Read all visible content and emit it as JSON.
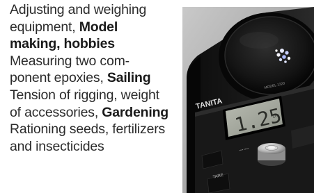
{
  "text": {
    "line1": "Adjusting and weighing",
    "line2": "equipment,",
    "line2_bold": "Model",
    "line3_bold": "making, hobbies",
    "line4": "Measuring two com-",
    "line5": "ponent epoxies,",
    "line5_bold": "Sailing",
    "line6": "Tension of rigging, weight",
    "line7": "of accessories,",
    "line7_bold": "Gardening",
    "line8": "Rationing seeds, fertilizers",
    "line9": "and insecticides"
  },
  "device": {
    "brand": "TANITA",
    "display_reading": "1.25",
    "model_label": "MODEL 1220",
    "key_label": "TARE"
  }
}
